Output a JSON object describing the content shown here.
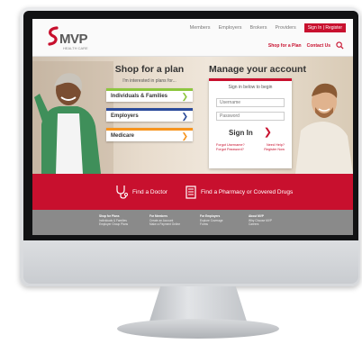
{
  "brand": {
    "name": "MVP",
    "tagline": "HEALTH CARE",
    "red": "#c8102e",
    "gray": "#5a5a5a"
  },
  "top_nav": [
    "Members",
    "Employers",
    "Brokers",
    "Providers"
  ],
  "signin_register": "Sign In | Register",
  "sub_nav": [
    "Shop for a Plan",
    "Contact Us"
  ],
  "shop": {
    "title": "Shop for a plan",
    "subtitle": "I'm interested in plans for...",
    "options": [
      {
        "label": "Individuals & Families",
        "color": "#8dc63f"
      },
      {
        "label": "Employers",
        "color": "#2b4b9b"
      },
      {
        "label": "Medicare",
        "color": "#f7941d"
      }
    ]
  },
  "account": {
    "title": "Manage your account",
    "subtitle": "Sign in below to begin",
    "username_placeholder": "Username",
    "password_placeholder": "Password",
    "signin_label": "Sign In",
    "forgot": "Forgot Username? Forgot Password?",
    "help": "Need Help? Register Now"
  },
  "quick_links": {
    "doctor": "Find a Doctor",
    "pharmacy": "Find a Pharmacy or Covered Drugs"
  },
  "footer": [
    {
      "heading": "Shop for Plans",
      "items": [
        "Individuals & Families",
        "Employer Group Plans"
      ]
    },
    {
      "heading": "For Members",
      "items": [
        "Create an Account",
        "Make a Payment Online"
      ]
    },
    {
      "heading": "For Employers",
      "items": [
        "Explore Coverage",
        "Forms"
      ]
    },
    {
      "heading": "About MVP",
      "items": [
        "Why Choose MVP",
        "Careers"
      ]
    }
  ]
}
